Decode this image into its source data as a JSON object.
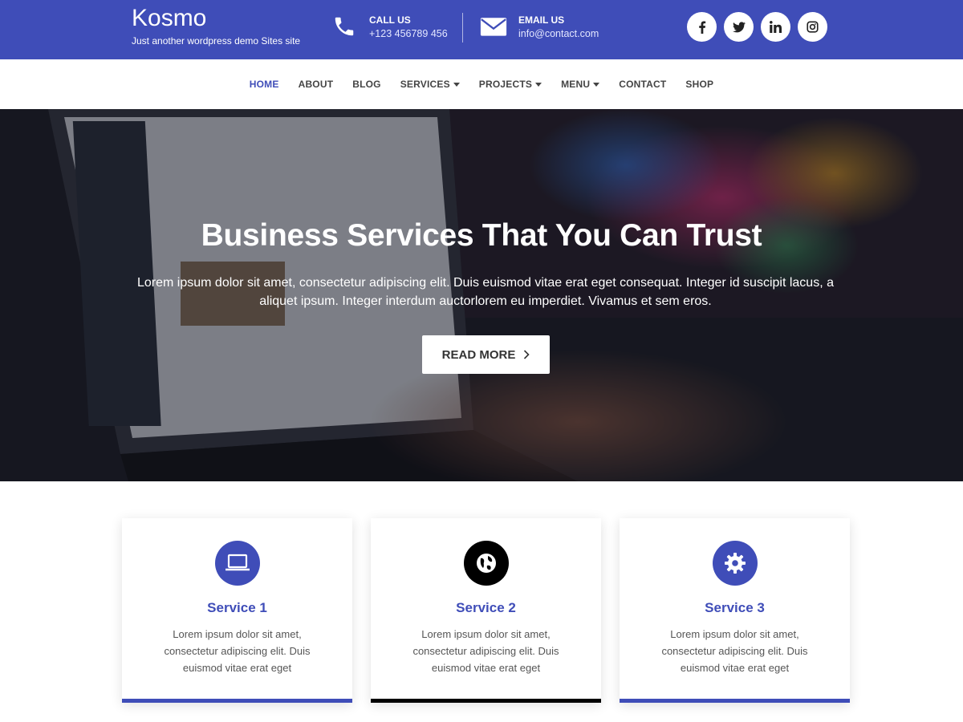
{
  "brand": {
    "title": "Kosmo",
    "tagline": "Just another wordpress demo Sites site"
  },
  "contact": {
    "call_label": "CALL US",
    "call_value": "+123 456789 456",
    "email_label": "EMAIL US",
    "email_value": "info@contact.com",
    "call_icon": "phone-icon",
    "email_icon": "envelope-icon"
  },
  "socials": [
    {
      "name": "facebook-icon",
      "glyph": "f"
    },
    {
      "name": "twitter-icon",
      "glyph": "t"
    },
    {
      "name": "linkedin-icon",
      "glyph": "in"
    },
    {
      "name": "instagram-icon",
      "glyph": "ig"
    }
  ],
  "nav": {
    "items": [
      {
        "label": "HOME",
        "active": true
      },
      {
        "label": "ABOUT"
      },
      {
        "label": "BLOG"
      },
      {
        "label": "SERVICES",
        "dropdown": true
      },
      {
        "label": "PROJECTS",
        "dropdown": true
      },
      {
        "label": "MENU",
        "dropdown": true
      },
      {
        "label": "CONTACT"
      },
      {
        "label": "SHOP"
      }
    ]
  },
  "hero": {
    "title": "Business Services That You Can Trust",
    "text": "Lorem ipsum dolor sit amet, consectetur adipiscing elit. Duis euismod vitae erat eget consequat. Integer id suscipit lacus, a aliquet ipsum. Integer interdum auctorlorem eu imperdiet. Vivamus et sem eros.",
    "button_label": "READ MORE",
    "button_icon": "chevron-right-icon"
  },
  "services": [
    {
      "title": "Service 1",
      "text": "Lorem ipsum dolor sit amet, consectetur adipiscing elit. Duis euismod vitae erat eget",
      "icon": "laptop-icon",
      "color": "#3f4db8"
    },
    {
      "title": "Service 2",
      "text": "Lorem ipsum dolor sit amet, consectetur adipiscing elit. Duis euismod vitae erat eget",
      "icon": "globe-icon",
      "color": "#000000"
    },
    {
      "title": "Service 3",
      "text": "Lorem ipsum dolor sit amet, consectetur adipiscing elit. Duis euismod vitae erat eget",
      "icon": "gear-icon",
      "color": "#3f4db8"
    }
  ],
  "colors": {
    "primary": "#3f4db8",
    "dark": "#000000"
  }
}
